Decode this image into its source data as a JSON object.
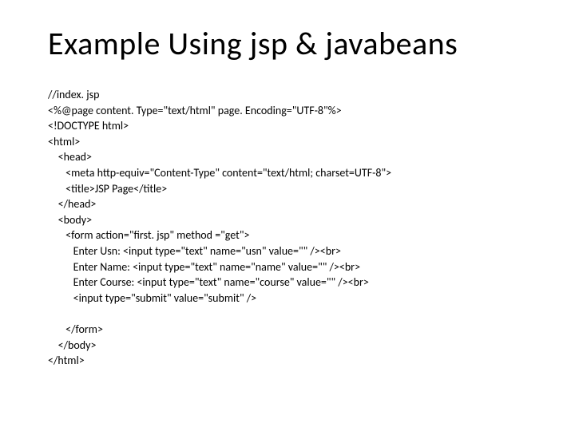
{
  "title": "Example Using jsp & javabeans",
  "code": "//index. jsp\n<%@page content. Type=\"text/html\" page. Encoding=\"UTF-8\"%>\n<!DOCTYPE html>\n<html>\n    <head>\n       <meta http-equiv=\"Content-Type\" content=\"text/html; charset=UTF-8\">\n       <title>JSP Page</title>\n    </head>\n    <body>\n       <form action=\"first. jsp\" method =\"get\">\n          Enter Usn: <input type=\"text\" name=\"usn\" value=\"\" /><br>\n          Enter Name: <input type=\"text\" name=\"name\" value=\"\" /><br>\n          Enter Course: <input type=\"text\" name=\"course\" value=\"\" /><br>\n          <input type=\"submit\" value=\"submit\" />\n\n       </form>\n    </body>\n</html>"
}
